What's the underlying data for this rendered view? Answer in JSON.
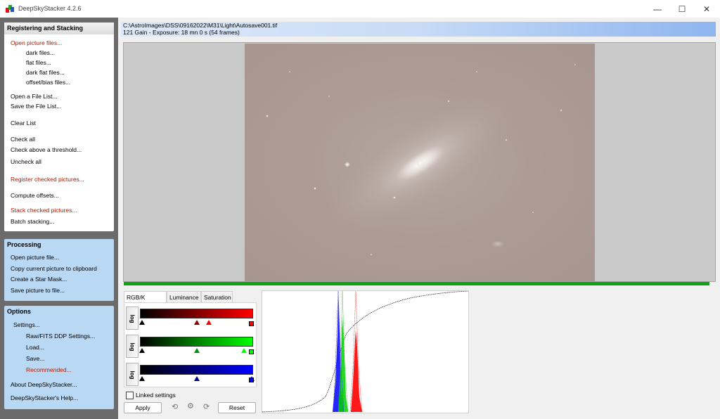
{
  "app": {
    "title": "DeepSkyStacker 4.2.6"
  },
  "window": {
    "minimize": "—",
    "maximize": "☐",
    "close": "✕"
  },
  "registering": {
    "header": "Registering and Stacking",
    "items": [
      {
        "label": "Open picture files...",
        "red": true,
        "indent": false
      },
      {
        "label": "dark files...",
        "red": false,
        "indent": true
      },
      {
        "label": "flat files...",
        "red": false,
        "indent": true
      },
      {
        "label": "dark flat files...",
        "red": false,
        "indent": true
      },
      {
        "label": "offset/bias files...",
        "red": false,
        "indent": true
      },
      {
        "label": "Open a File List...",
        "red": false,
        "indent": false
      },
      {
        "label": "Save the File List...",
        "red": false,
        "indent": false
      },
      {
        "label": "Clear List",
        "red": false,
        "indent": false
      },
      {
        "label": "Check all",
        "red": false,
        "indent": false
      },
      {
        "label": "Check above a threshold...",
        "red": false,
        "indent": false
      },
      {
        "label": "Uncheck all",
        "red": false,
        "indent": false
      },
      {
        "label": "Register checked pictures...",
        "red": true,
        "indent": false
      },
      {
        "label": "Compute offsets...",
        "red": false,
        "indent": false
      },
      {
        "label": "Stack checked pictures...",
        "red": true,
        "indent": false
      },
      {
        "label": "Batch stacking...",
        "red": false,
        "indent": false
      }
    ]
  },
  "processing": {
    "header": "Processing",
    "items": [
      "Open picture file...",
      "Copy current picture to clipboard",
      "Create a Star Mask...",
      "Save picture to file..."
    ]
  },
  "options": {
    "header": "Options",
    "items": [
      {
        "label": "Settings...",
        "red": false,
        "level": 1
      },
      {
        "label": "Raw/FITS DDP Settings...",
        "red": false,
        "level": 2
      },
      {
        "label": "Load...",
        "red": false,
        "level": 2
      },
      {
        "label": "Save...",
        "red": false,
        "level": 2
      },
      {
        "label": "Recommended...",
        "red": true,
        "level": 2
      },
      {
        "label": "About DeepSkyStacker...",
        "red": false,
        "level": 0
      },
      {
        "label": "DeepSkyStacker's Help...",
        "red": false,
        "level": 0
      }
    ]
  },
  "file": {
    "path": "C:\\AstroImages\\DSS\\09162022\\M31\\Light\\Autosave001.tif",
    "info": "121 Gain - Exposure: 18 mn 0 s (54 frames)"
  },
  "progress": {
    "value": 1.0
  },
  "tabs": [
    {
      "label": "RGB/K Levels",
      "active": true
    },
    {
      "label": "Luminance",
      "active": false
    },
    {
      "label": "Saturation",
      "active": false
    }
  ],
  "levels": {
    "log_label": "log",
    "channels": [
      {
        "name": "red",
        "color": "#ff0000",
        "markers": [
          0.02,
          0.5,
          0.61
        ],
        "end": 0.98
      },
      {
        "name": "green",
        "color": "#00ff00",
        "markers": [
          0.02,
          0.5,
          0.92
        ],
        "end": 0.98
      },
      {
        "name": "blue",
        "color": "#0000ff",
        "markers": [
          0.02,
          0.5,
          0.99
        ],
        "end": 0.98
      }
    ]
  },
  "controls": {
    "linked": "Linked settings",
    "apply": "Apply",
    "reset": "Reset"
  },
  "colors": {
    "sidebar_bg": "#6b6b6b",
    "panel_blue": "#b9d8f3",
    "red_link": "#b01a00",
    "progress": "#12a312"
  }
}
